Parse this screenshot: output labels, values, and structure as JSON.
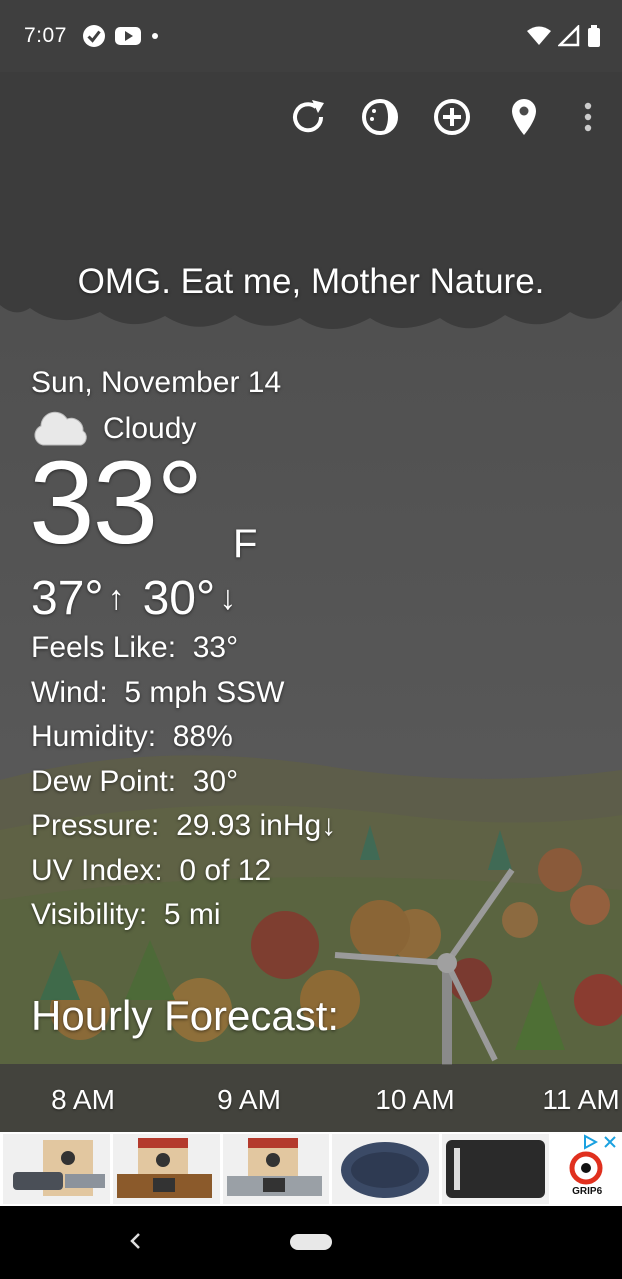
{
  "status_bar": {
    "time": "7:07",
    "left_icons": [
      "check-circle-icon",
      "youtube-icon",
      "dot-icon"
    ],
    "right_icons": [
      "wifi-icon",
      "signal-icon",
      "battery-icon"
    ]
  },
  "toolbar": {
    "icons": [
      "refresh-icon",
      "theme-icon",
      "add-location-icon",
      "location-pin-icon",
      "more-vert-icon"
    ]
  },
  "tagline": "OMG. Eat me, Mother Nature.",
  "current": {
    "date": "Sun, November 14",
    "condition": "Cloudy",
    "condition_icon": "cloud-icon",
    "temperature": "33°",
    "unit": "F",
    "high": "37°",
    "low": "30°",
    "high_arrow": "↑",
    "low_arrow": "↓"
  },
  "details": [
    {
      "label": "Feels Like:",
      "value": "33°"
    },
    {
      "label": "Wind:",
      "value": "5 mph SSW"
    },
    {
      "label": "Humidity:",
      "value": "88%"
    },
    {
      "label": "Dew Point:",
      "value": "30°"
    },
    {
      "label": "Pressure:",
      "value": "29.93 inHg↓"
    },
    {
      "label": "UV Index:",
      "value": "0 of 12"
    },
    {
      "label": "Visibility:",
      "value": "5 mi"
    }
  ],
  "hourly": {
    "title": "Hourly Forecast:",
    "hours": [
      "8 AM",
      "9 AM",
      "10 AM",
      "11 AM"
    ]
  },
  "ad": {
    "brand_text": "GRIP6",
    "close_icon": "close-icon",
    "adchoices_icon": "adchoices-icon"
  },
  "colors": {
    "sky_dark": "#3f3f3f",
    "sky_mid": "#555555",
    "text": "#ffffff"
  }
}
